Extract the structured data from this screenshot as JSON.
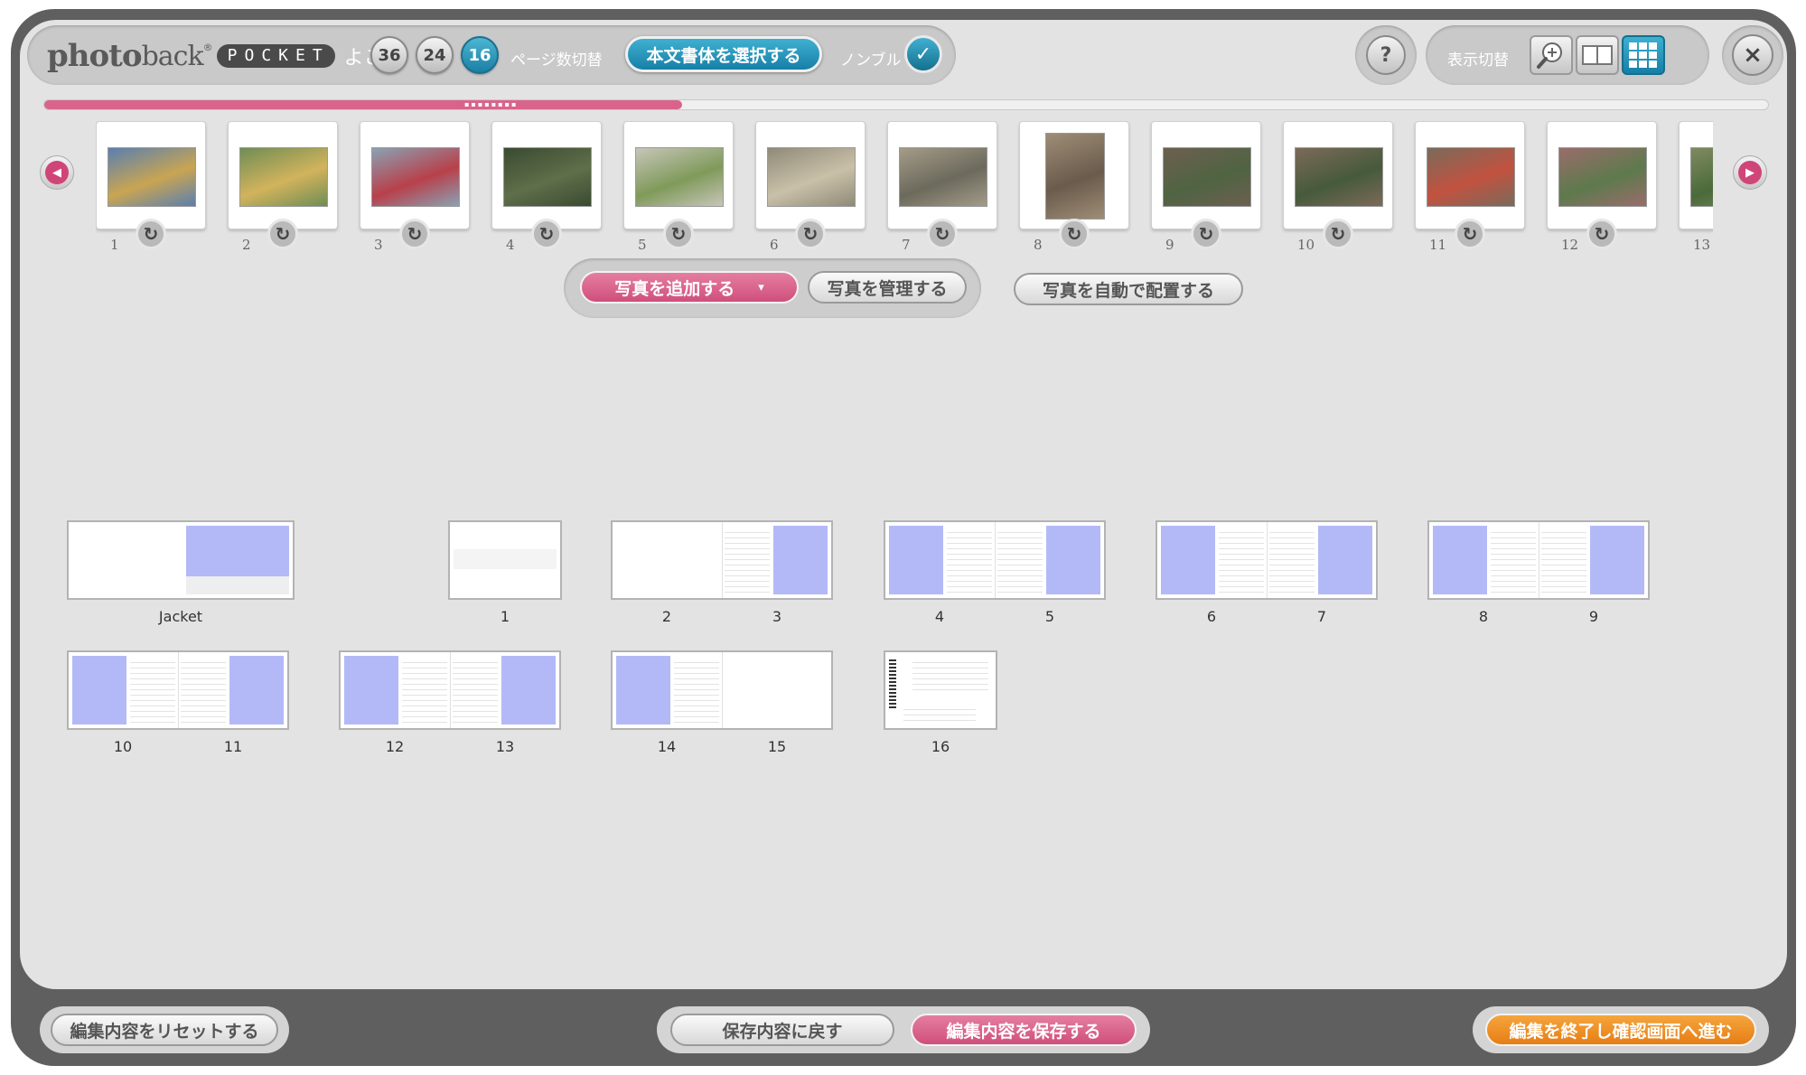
{
  "header": {
    "logo_main": "photo",
    "logo_main2": "back",
    "logo_reg": "®",
    "logo_sub": "POCKET",
    "orientation": "よこ",
    "page_counts": [
      "36",
      "24",
      "16"
    ],
    "active_page_count": "16",
    "page_count_label": "ページ数切替",
    "font_select_button": "本文書体を選択する",
    "finish_label": "ノンブル",
    "help_label": "?",
    "view_switch_label": "表示切替",
    "close_label": "×"
  },
  "progress": {
    "fraction": 0.37
  },
  "photo_strip": {
    "prev_label": "◀",
    "next_label": "▶",
    "photos": [
      {
        "num": "1"
      },
      {
        "num": "2"
      },
      {
        "num": "3"
      },
      {
        "num": "4"
      },
      {
        "num": "5"
      },
      {
        "num": "6"
      },
      {
        "num": "7"
      },
      {
        "num": "8"
      },
      {
        "num": "9"
      },
      {
        "num": "10"
      },
      {
        "num": "11"
      },
      {
        "num": "12"
      },
      {
        "num": "13"
      }
    ]
  },
  "actions": {
    "add_photos": "写真を追加する",
    "add_photos_caret": "▾",
    "manage_photos": "写真を管理する",
    "auto_place": "写真を自動で配置する"
  },
  "pages": {
    "jacket": "Jacket",
    "labels": [
      "1",
      "2",
      "3",
      "4",
      "5",
      "6",
      "7",
      "8",
      "9",
      "10",
      "11",
      "12",
      "13",
      "14",
      "15",
      "16"
    ]
  },
  "footer": {
    "reset": "編集内容をリセットする",
    "revert": "保存内容に戻す",
    "save": "編集内容を保存する",
    "finish": "編集を終了し確認画面へ進む"
  },
  "colors": {
    "accent_blue": "#1b7fa3",
    "accent_pink": "#cf4f7c",
    "accent_orange": "#e67e14",
    "photo_placeholder": "#b3b9f7"
  }
}
